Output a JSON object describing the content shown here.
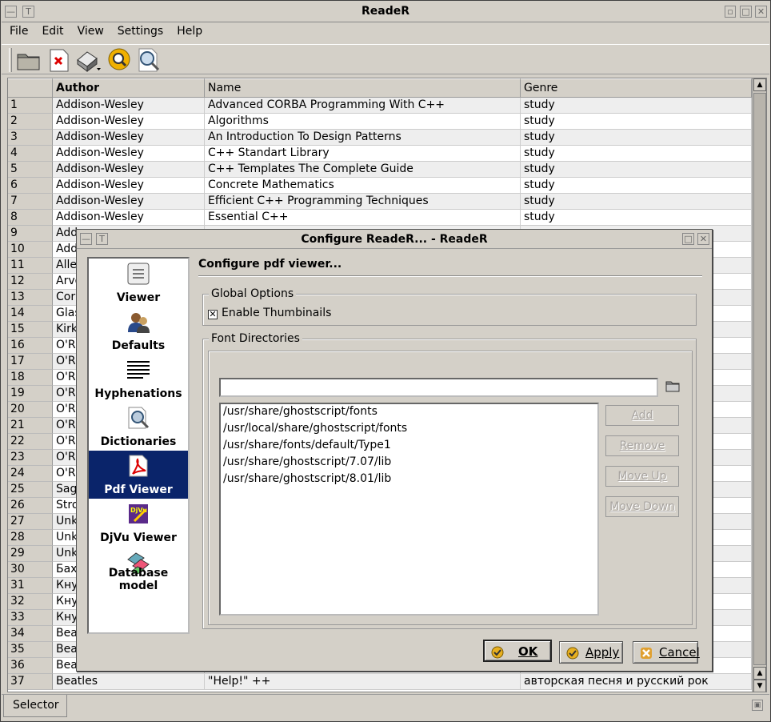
{
  "window": {
    "title": "ReadeR"
  },
  "menu": [
    "File",
    "Edit",
    "View",
    "Settings",
    "Help"
  ],
  "toolbar": {
    "icons": [
      "open-folder-icon",
      "close-document-icon",
      "book-dropdown-icon",
      "search-icon",
      "zoom-icon"
    ]
  },
  "table": {
    "columns": [
      "",
      "Author",
      "Name",
      "Genre"
    ],
    "rows": [
      [
        "1",
        "Addison-Wesley",
        "Advanced CORBA Programming With C++",
        "study"
      ],
      [
        "2",
        "Addison-Wesley",
        "Algorithms",
        "study"
      ],
      [
        "3",
        "Addison-Wesley",
        "An Introduction To Design Patterns",
        "study"
      ],
      [
        "4",
        "Addison-Wesley",
        "C++ Standart Library",
        "study"
      ],
      [
        "5",
        "Addison-Wesley",
        "C++ Templates The Complete Guide",
        "study"
      ],
      [
        "6",
        "Addison-Wesley",
        "Concrete Mathematics",
        "study"
      ],
      [
        "7",
        "Addison-Wesley",
        "Efficient C++ Programming Techniques",
        "study"
      ],
      [
        "8",
        "Addison-Wesley",
        "Essential C++",
        "study"
      ],
      [
        "9",
        "Add",
        "",
        ""
      ],
      [
        "10",
        "Add",
        "",
        ""
      ],
      [
        "11",
        "Aller",
        "",
        ""
      ],
      [
        "12",
        "Arvo",
        "",
        ""
      ],
      [
        "13",
        "Cor",
        "",
        ""
      ],
      [
        "14",
        "Glas",
        "",
        ""
      ],
      [
        "15",
        "Kirk",
        "",
        ""
      ],
      [
        "16",
        "O'R",
        "",
        ""
      ],
      [
        "17",
        "O'R",
        "",
        ""
      ],
      [
        "18",
        "O'R",
        "",
        ""
      ],
      [
        "19",
        "O'R",
        "",
        ""
      ],
      [
        "20",
        "O'R",
        "",
        ""
      ],
      [
        "21",
        "O'R",
        "",
        ""
      ],
      [
        "22",
        "O'R",
        "",
        ""
      ],
      [
        "23",
        "O'R",
        "",
        ""
      ],
      [
        "24",
        "O'R",
        "",
        ""
      ],
      [
        "25",
        "Sag",
        "",
        ""
      ],
      [
        "26",
        "Stro",
        "",
        ""
      ],
      [
        "27",
        "Unk",
        "",
        ""
      ],
      [
        "28",
        "Unk",
        "",
        ""
      ],
      [
        "29",
        "Unk",
        "",
        ""
      ],
      [
        "30",
        "Бах",
        "",
        ""
      ],
      [
        "31",
        "Кну",
        "",
        ""
      ],
      [
        "32",
        "Кну",
        "",
        ""
      ],
      [
        "33",
        "Кну",
        "",
        ""
      ],
      [
        "34",
        "Bea",
        "",
        ""
      ],
      [
        "35",
        "Bea",
        "",
        ""
      ],
      [
        "36",
        "Bea",
        "",
        ""
      ],
      [
        "37",
        "Beatles",
        "\"Help!\" ++",
        "авторская песня и русский рок"
      ]
    ]
  },
  "status": {
    "tab": "Selector"
  },
  "dialog": {
    "title": "Configure ReadeR... - ReadeR",
    "pane_title": "Configure pdf viewer...",
    "nav": [
      "Viewer",
      "Defaults",
      "Hyphenations",
      "Dictionaries",
      "Pdf Viewer",
      "DjVu Viewer",
      "Database model"
    ],
    "selected_nav": "Pdf Viewer",
    "global_options_label": "Global Options",
    "enable_thumbnails_label": "Enable Thumbinails",
    "enable_thumbnails_checked": "true",
    "font_dirs_label": "Font Directories",
    "dir_input_value": "",
    "font_dirs": [
      "/usr/share/ghostscript/fonts",
      "/usr/local/share/ghostscript/fonts",
      "/usr/share/fonts/default/Type1",
      "/usr/share/ghostscript/7.07/lib",
      "/usr/share/ghostscript/8.01/lib"
    ],
    "side_buttons": [
      "Add",
      "Remove",
      "Move Up",
      "Move Down"
    ],
    "ok_label": "OK",
    "apply_label": "Apply",
    "cancel_label": "Cancel"
  },
  "colors": {
    "selection": "#0a246a",
    "face": "#d4d0c8",
    "ok_icon": "#e8b020",
    "cancel_icon": "#e0a030"
  }
}
